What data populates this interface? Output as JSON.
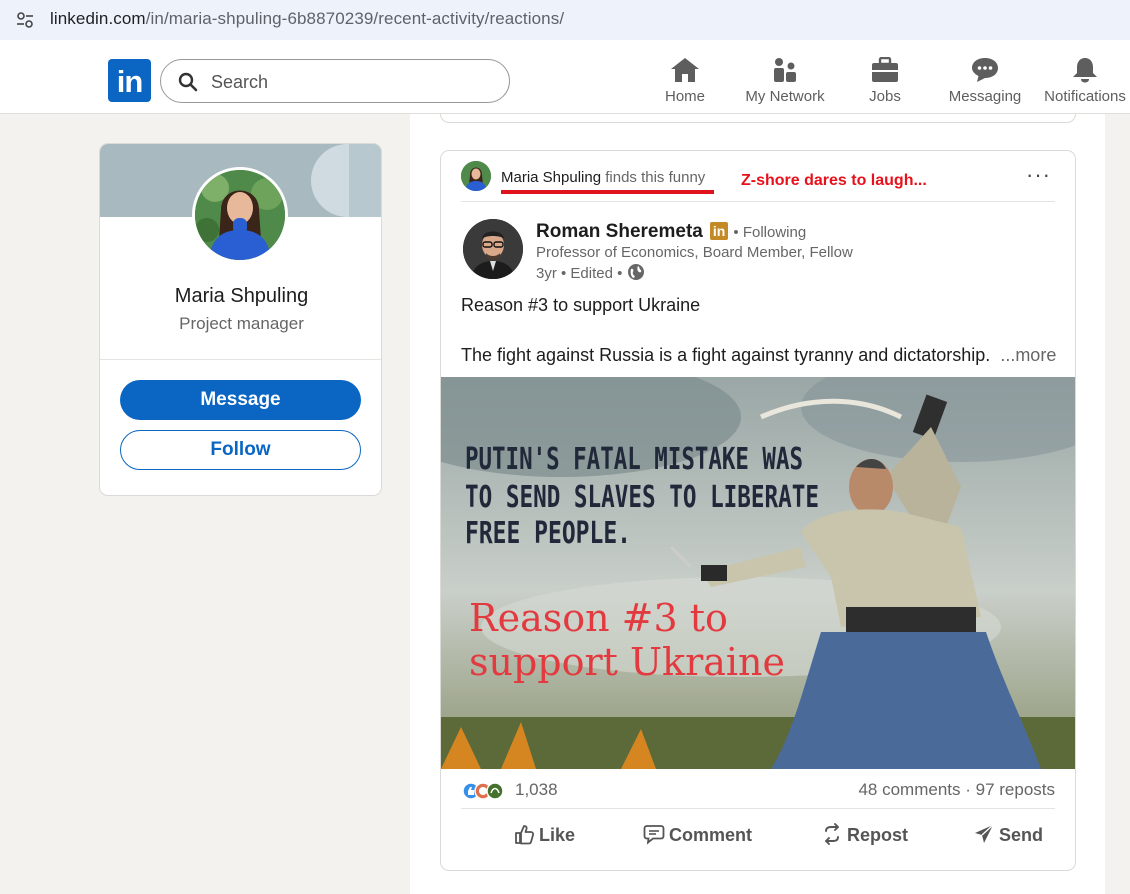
{
  "browser": {
    "url_host": "linkedin.com",
    "url_path": "/in/maria-shpuling-6b8870239/recent-activity/reactions/"
  },
  "nav": {
    "logo": "in",
    "search_placeholder": "Search",
    "items": [
      {
        "label": "Home",
        "icon": "home-icon"
      },
      {
        "label": "My Network",
        "icon": "network-icon"
      },
      {
        "label": "Jobs",
        "icon": "briefcase-icon"
      },
      {
        "label": "Messaging",
        "icon": "chat-icon"
      },
      {
        "label": "Notifications",
        "icon": "bell-icon"
      }
    ]
  },
  "profile": {
    "name": "Maria Shpuling",
    "title": "Project manager",
    "message_label": "Message",
    "follow_label": "Follow"
  },
  "post": {
    "reactor_name": "Maria Shpuling",
    "reactor_action": "finds this funny",
    "annotation": "Z-shore dares to laugh...",
    "more_menu": "···",
    "author_name": "Roman Sheremeta",
    "author_badge": "in",
    "following": "• Following",
    "author_headline": "Professor of Economics, Board Member, Fellow",
    "author_meta": "3yr • Edited •",
    "text_line1": "Reason #3 to support Ukraine",
    "text_line2": "The fight against Russia is a fight against tyranny and dictatorship.",
    "see_more": "...more",
    "image_text_main": [
      "PUTIN'S FATAL MISTAKE WAS",
      "TO SEND SLAVES TO LIBERATE",
      "FREE PEOPLE."
    ],
    "image_text_red": [
      "Reason #3 to",
      "support Ukraine"
    ],
    "reaction_count": "1,038",
    "comments_reposts": "48 comments · 97 reposts",
    "actions": {
      "like": "Like",
      "comment": "Comment",
      "repost": "Repost",
      "send": "Send"
    }
  },
  "colors": {
    "linkedin_blue": "#0a66c2",
    "annotation_red": "#e8111b",
    "page_bg": "#f4f2ee"
  }
}
